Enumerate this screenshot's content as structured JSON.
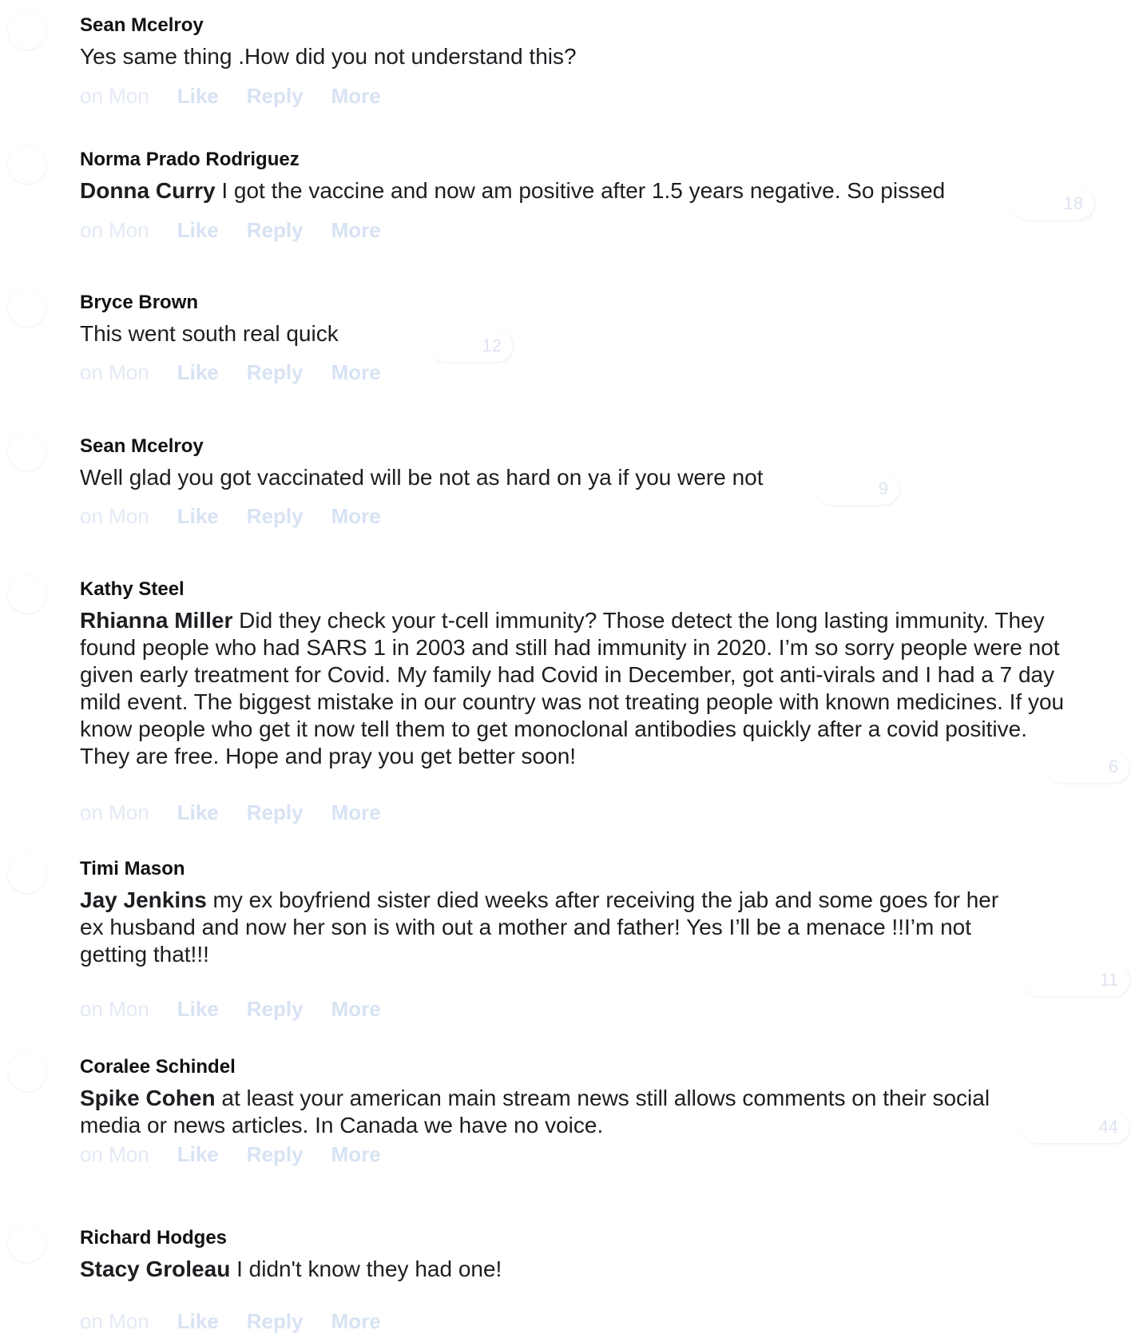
{
  "comments": [
    {
      "author": "Sean Mcelroy",
      "mention": "",
      "text": "Yes same thing .How did you not understand this?",
      "reactions": "",
      "time": "on Mon"
    },
    {
      "author": "Norma Prado Rodriguez",
      "mention": "Donna Curry",
      "text": " I got the vaccine and now am positive after 1.5 years negative. So pissed",
      "reactions": "18",
      "time": "on Mon"
    },
    {
      "author": "Bryce Brown",
      "mention": "",
      "text": "This went south real quick",
      "reactions": "12",
      "time": "on Mon"
    },
    {
      "author": "Sean Mcelroy",
      "mention": "",
      "text": "Well glad you got vaccinated will be not as hard on ya if you were not",
      "reactions": "9",
      "time": "on Mon"
    },
    {
      "author": "Kathy Steel",
      "mention": "Rhianna Miller",
      "text": " Did they check your t-cell immunity? Those detect the long lasting immunity. They found people who had SARS 1 in 2003 and still had immunity in 2020. I’m so sorry people were not given early treatment for Covid. My family had Covid in December, got anti-virals and I had a 7 day mild event. The biggest mistake in our country was not treating people with known medicines. If you know people who get it now tell them to get monoclonal antibodies quickly after a covid positive. They are free. Hope and pray you get better soon!",
      "reactions": "6",
      "time": "on Mon"
    },
    {
      "author": "Timi Mason",
      "mention": "Jay Jenkins",
      "text": " my ex boyfriend sister died weeks after receiving the jab and some goes for her ex husband and now her son is with out a mother and father! Yes I’ll be a menace !!I’m not getting that!!!",
      "reactions": "11",
      "time": "on Mon"
    },
    {
      "author": "Coralee Schindel",
      "mention": "Spike Cohen",
      "text": " at least your american main stream news still allows comments on their social media or news articles. In Canada we have no voice.",
      "reactions": "44",
      "time": "on Mon"
    },
    {
      "author": "Richard Hodges",
      "mention": "Stacy Groleau",
      "text": " I didn't know they had one!",
      "reactions": "",
      "time": "on Mon"
    }
  ],
  "actions": {
    "like": "Like",
    "reply": "Reply",
    "more": "More"
  },
  "colors": {
    "action_text": "#d7e2f3",
    "time_text": "#e3e9f5",
    "reaction_count": "#dde4f0"
  }
}
